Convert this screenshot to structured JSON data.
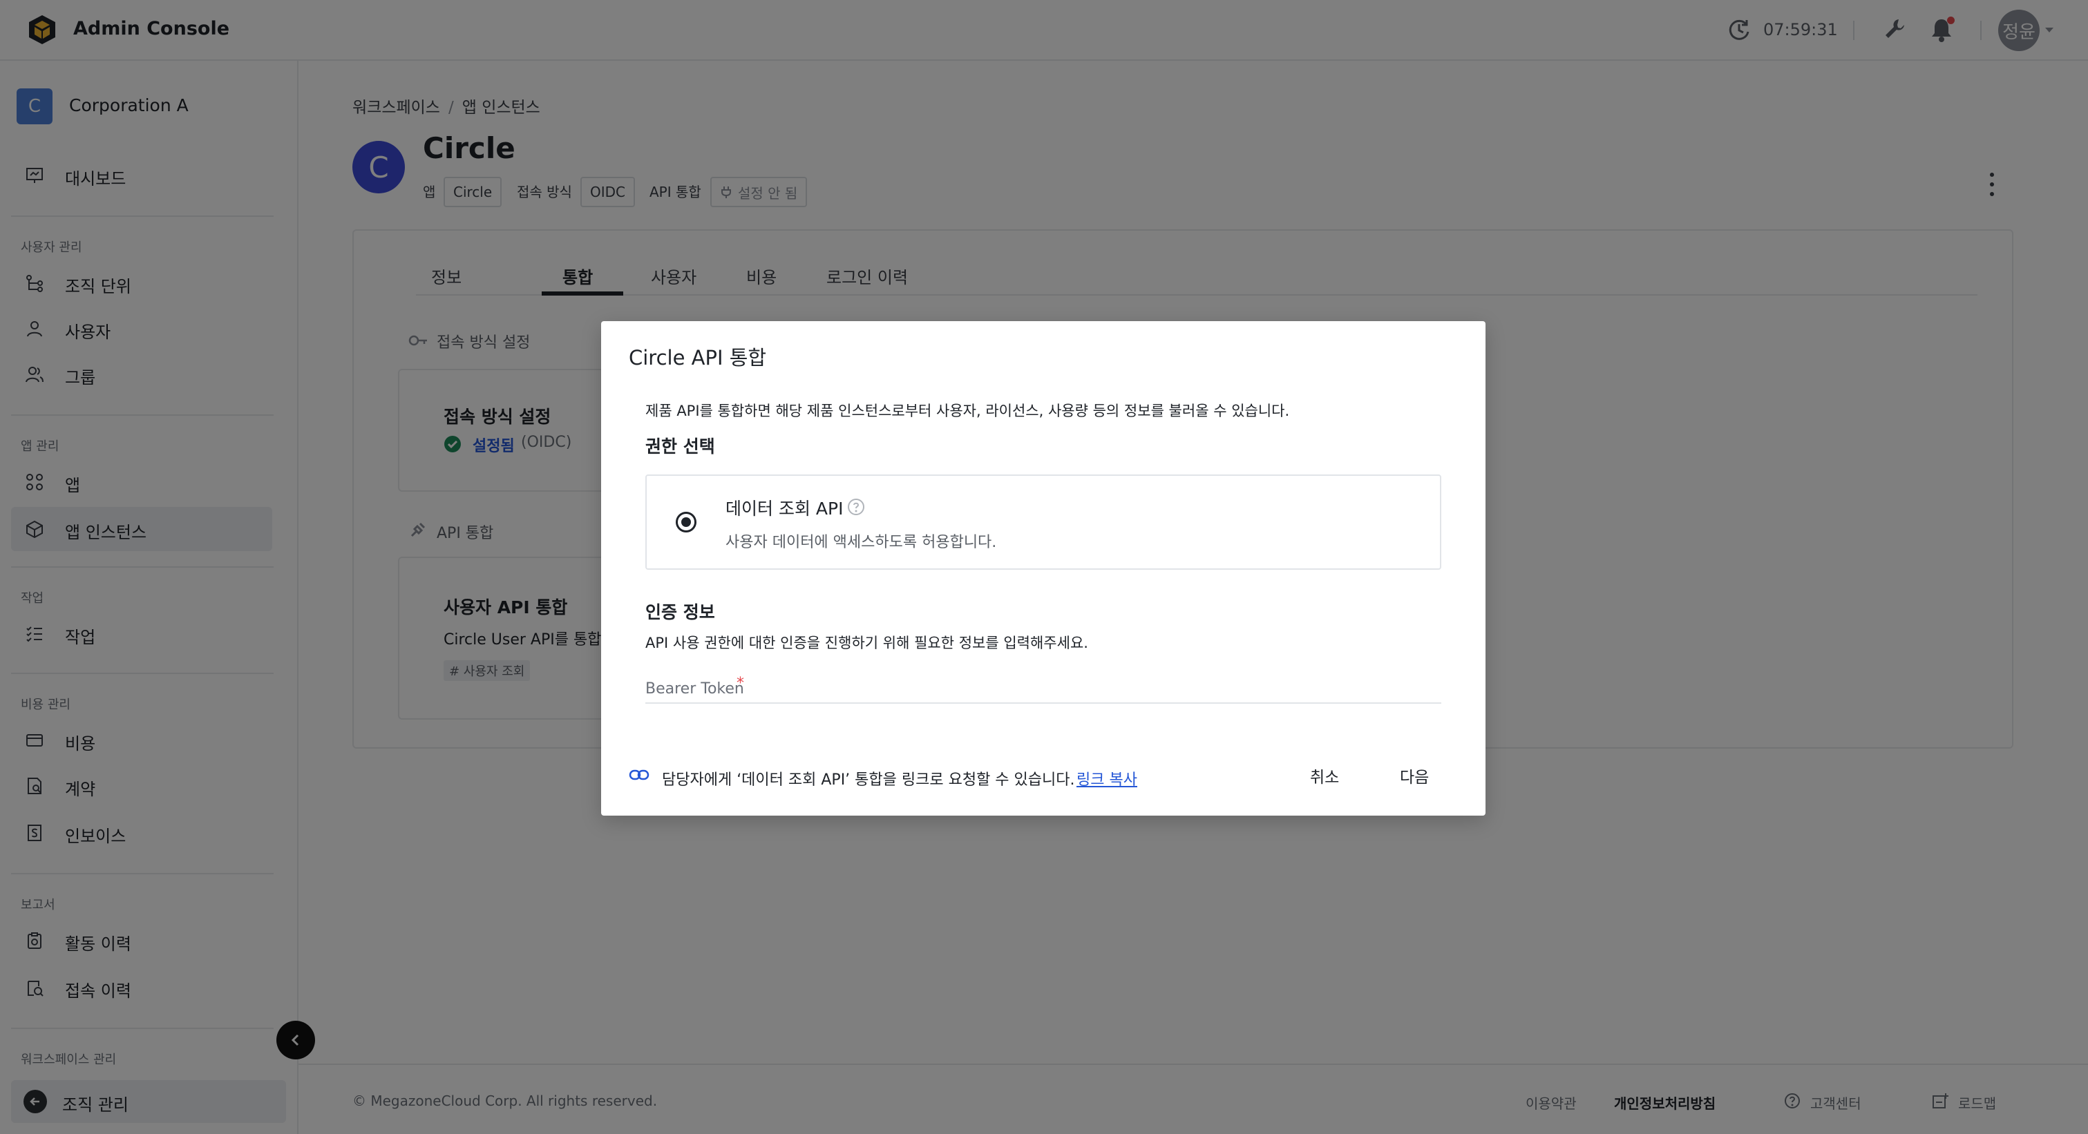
{
  "header": {
    "app_title": "Admin Console",
    "time": "07:59:31",
    "avatar_text": "정윤"
  },
  "sidebar": {
    "org_initial": "C",
    "org_name": "Corporation A",
    "dashboard": "대시보드",
    "sections": {
      "user_mgmt": "사용자 관리",
      "app_mgmt": "앱 관리",
      "tasks": "작업",
      "cost_mgmt": "비용 관리",
      "reports": "보고서",
      "workspace_mgmt": "워크스페이스 관리"
    },
    "items": {
      "org_unit": "조직 단위",
      "users": "사용자",
      "groups": "그룹",
      "apps": "앱",
      "app_instances": "앱 인스턴스",
      "tasks": "작업",
      "cost": "비용",
      "contracts": "계약",
      "invoices": "인보이스",
      "activity_log": "활동 이력",
      "access_log": "접속 이력"
    },
    "back_item": "조직 관리"
  },
  "breadcrumb": {
    "workspace": "워크스페이스",
    "sep": "/",
    "current": "앱 인스턴스"
  },
  "instance": {
    "initial": "C",
    "title": "Circle",
    "meta": {
      "app_label": "앱",
      "app_value": "Circle",
      "access_label": "접속 방식",
      "access_value": "OIDC",
      "api_label": "API 통합",
      "api_value": "설정 안 됨"
    }
  },
  "tabs": [
    "정보",
    "통합",
    "사용자",
    "비용",
    "로그인 이력"
  ],
  "content": {
    "access_section": "접속 방식 설정",
    "access_card_title": "접속 방식 설정",
    "access_status": "설정됨",
    "access_status_detail": "(OIDC)",
    "api_section": "API 통합",
    "api_card_title": "사용자 API 통합",
    "api_card_desc": "Circle User API를 통합하",
    "api_card_tag": "# 사용자 조회"
  },
  "modal": {
    "title": "Circle API 통합",
    "description": "제품 API를 통합하면 해당 제품 인스턴스로부터 사용자, 라이선스, 사용량 등의 정보를 불러올 수 있습니다.",
    "permission_heading": "권한 선택",
    "permission_name": "데이터 조회 API",
    "permission_desc": "사용자 데이터에 액세스하도록 허용합니다.",
    "auth_heading": "인증 정보",
    "auth_desc": "API 사용 권한에 대한 인증을 진행하기 위해 필요한 정보를 입력해주세요.",
    "token_placeholder": "Bearer Token",
    "token_value": "",
    "required_mark": "*",
    "share_text": "담당자에게 ‘데이터 조회 API’ 통합을 링크로 요청할 수 있습니다.",
    "copy_link": "링크 복사",
    "cancel": "취소",
    "next": "다음"
  },
  "footer": {
    "copyright": "© MegazoneCloud Corp. All rights reserved.",
    "terms": "이용약관",
    "privacy": "개인정보처리방침",
    "support": "고객센터",
    "roadmap": "로드맵"
  }
}
